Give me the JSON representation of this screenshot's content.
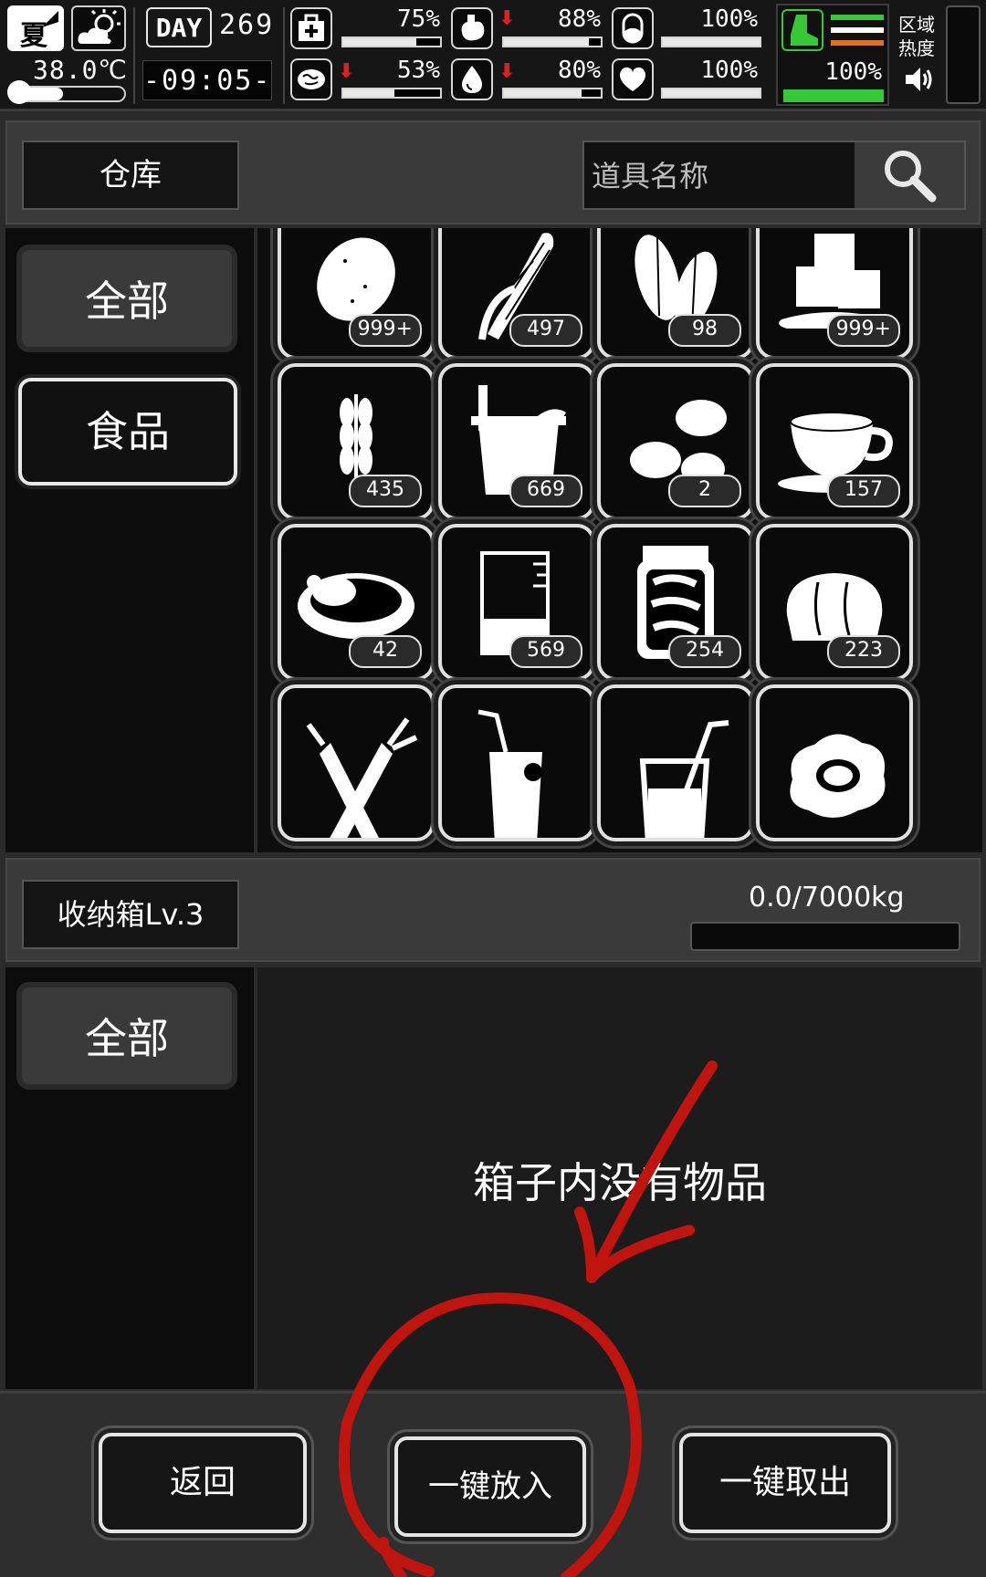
{
  "status": {
    "season": "夏",
    "weather_icon": "sun-cloud-icon",
    "temperature": "38.0℃",
    "thermometer_level": 0.45,
    "day_label": "DAY",
    "day_number": "269",
    "clock": "-09:05-",
    "stats": [
      {
        "name": "health",
        "icon": "medkit-icon",
        "pct": "75%",
        "level": 0.75,
        "trend_down": false
      },
      {
        "name": "hunger",
        "icon": "stomach-icon",
        "pct": "88%",
        "level": 0.88,
        "trend_down": true
      },
      {
        "name": "capsule",
        "icon": "capsule-icon",
        "pct": "100%",
        "level": 1.0,
        "trend_down": false
      },
      {
        "name": "brain",
        "icon": "brain-icon",
        "pct": "53%",
        "level": 0.53,
        "trend_down": true
      },
      {
        "name": "thirst",
        "icon": "water-drop-icon",
        "pct": "80%",
        "level": 0.8,
        "trend_down": true
      },
      {
        "name": "mood",
        "icon": "heart-icon",
        "pct": "100%",
        "level": 1.0,
        "trend_down": false
      }
    ],
    "stamina": {
      "icon": "boot-icon",
      "pct": "100%",
      "level": 1.0
    },
    "region_heat_label": "区域热度",
    "sound_icon": "speaker-icon"
  },
  "warehouse": {
    "title": "仓库",
    "search_placeholder": "道具名称",
    "categories": [
      {
        "label": "全部",
        "active": false
      },
      {
        "label": "食品",
        "active": true
      }
    ],
    "items": [
      {
        "icon": "potato-icon",
        "count": "999+"
      },
      {
        "icon": "corn-icon",
        "count": "497"
      },
      {
        "icon": "seeds-icon",
        "count": "98"
      },
      {
        "icon": "ice-cubes-icon",
        "count": "999+"
      },
      {
        "icon": "wheat-icon",
        "count": "435"
      },
      {
        "icon": "bucket-icon",
        "count": "669"
      },
      {
        "icon": "beans-icon",
        "count": "2"
      },
      {
        "icon": "coffee-cup-icon",
        "count": "157"
      },
      {
        "icon": "chicken-soup-icon",
        "count": "42"
      },
      {
        "icon": "beaker-icon",
        "count": "569"
      },
      {
        "icon": "pickle-jar-icon",
        "count": "254"
      },
      {
        "icon": "bread-icon",
        "count": "223"
      },
      {
        "icon": "carrot-icon",
        "count": ""
      },
      {
        "icon": "juice-glass-icon",
        "count": ""
      },
      {
        "icon": "drink-straw-icon",
        "count": ""
      },
      {
        "icon": "fried-egg-icon",
        "count": ""
      }
    ]
  },
  "storage": {
    "title": "收纳箱Lv.3",
    "capacity": "0.0/7000kg",
    "capacity_level": 0.0,
    "categories": [
      {
        "label": "全部",
        "active": false
      }
    ],
    "empty_message": "箱子内没有物品"
  },
  "footer": {
    "back_label": "返回",
    "store_all_label": "一键放入",
    "take_all_label": "一键取出"
  },
  "colors": {
    "annotation": "#c0140e",
    "stamina_green": "#37c837",
    "stamina_orange": "#e07020",
    "alert_red": "#e02020"
  }
}
